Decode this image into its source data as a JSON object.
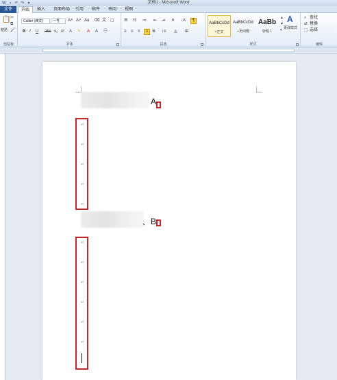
{
  "window": {
    "title": "文档1 - Microsoft Word"
  },
  "tabs": {
    "file": "文件",
    "home": "开始",
    "insert": "插入",
    "layout": "页面布局",
    "references": "引用",
    "mailings": "邮件",
    "review": "审阅",
    "view": "视图"
  },
  "ribbon": {
    "clipboard": {
      "label": "剪贴板",
      "paste": "粘贴"
    },
    "font": {
      "label": "字体",
      "font_name": "Calibri (西文)",
      "font_size": "一号"
    },
    "paragraph": {
      "label": "段落"
    },
    "styles": {
      "label": "样式",
      "items": [
        {
          "sample": "AaBbCcDd",
          "name": "+正文"
        },
        {
          "sample": "AaBbCcDd",
          "name": "+无间隔"
        },
        {
          "sample": "AaBb",
          "name": "标题 1"
        }
      ],
      "change_styles": "更改样式"
    },
    "editing": {
      "label": "编辑",
      "find": "查找",
      "replace": "替换",
      "select": "选择"
    }
  },
  "document": {
    "heading_a_suffix": "A",
    "heading_b_suffix": "B",
    "b_separator": "、",
    "paragraph_mark": "↵"
  },
  "colors": {
    "annotation": "#c0272d",
    "file_tab": "#2b5797"
  }
}
